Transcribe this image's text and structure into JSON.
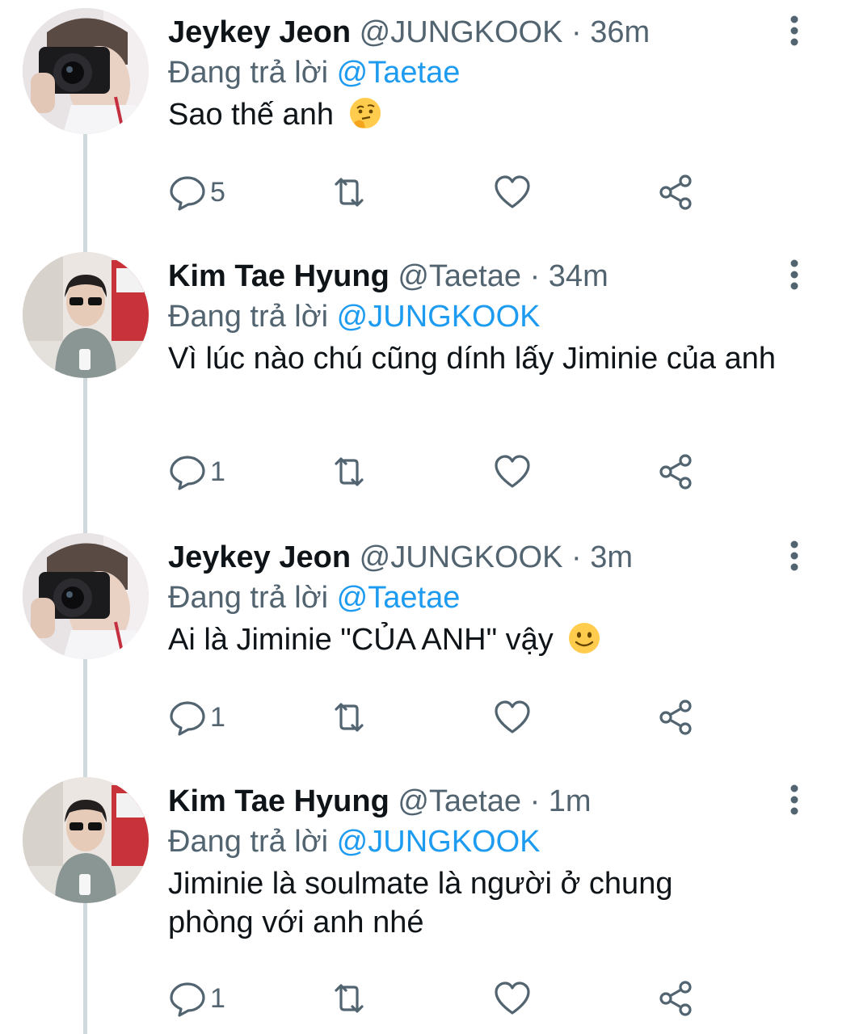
{
  "tweets": [
    {
      "name": "Jeykey Jeon",
      "handle": "@JUNGKOOK",
      "separator": "·",
      "time": "36m",
      "reply_prefix": "Đang trả lời",
      "reply_to": "@Taetae",
      "text": "Sao thế anh",
      "emoji": "thinking-face-emoji",
      "reply_count": "5",
      "avatar": "camera-avatar"
    },
    {
      "name": "Kim Tae Hyung",
      "handle": "@Taetae",
      "separator": "·",
      "time": "34m",
      "reply_prefix": "Đang trả lời",
      "reply_to": "@JUNGKOOK",
      "text": "Vì lúc nào chú cũng dính lấy Jiminie của anh",
      "emoji": "",
      "reply_count": "1",
      "avatar": "sunglasses-avatar"
    },
    {
      "name": "Jeykey Jeon",
      "handle": "@JUNGKOOK",
      "separator": "·",
      "time": "3m",
      "reply_prefix": "Đang trả lời",
      "reply_to": "@Taetae",
      "text": "Ai là Jiminie \"CỦA ANH\" vậy",
      "emoji": "slightly-smiling-face-emoji",
      "reply_count": "1",
      "avatar": "camera-avatar"
    },
    {
      "name": "Kim Tae Hyung",
      "handle": "@Taetae",
      "separator": "·",
      "time": "1m",
      "reply_prefix": "Đang trả lời",
      "reply_to": "@JUNGKOOK",
      "text": "Jiminie là soulmate là người ở chung phòng với anh nhé",
      "emoji": "",
      "reply_count": "1",
      "avatar": "sunglasses-avatar"
    }
  ],
  "icons": {
    "reply": "reply-icon",
    "retweet": "retweet-icon",
    "like": "heart-icon",
    "share": "share-icon",
    "more": "more-vertical-icon"
  },
  "colors": {
    "text": "#0f1419",
    "secondary": "#536471",
    "mention": "#1d9bf0",
    "thread_line": "#cfd9de"
  }
}
